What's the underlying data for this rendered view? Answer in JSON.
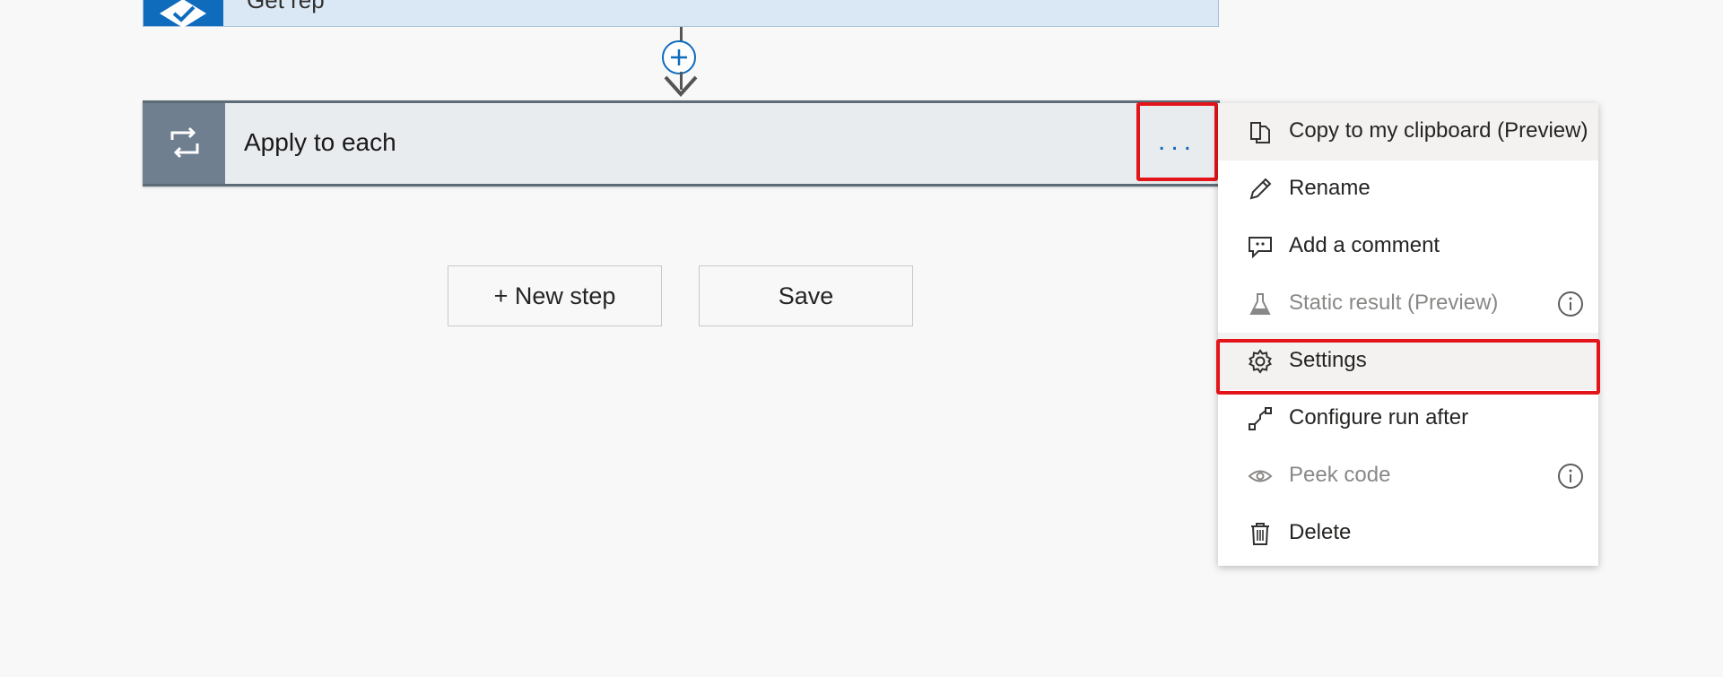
{
  "top_card": {
    "title": "Get rep",
    "icon": "check-icon"
  },
  "connector": {
    "add_icon": "plus-circle-icon",
    "arrow_icon": "arrow-down-icon"
  },
  "apply_card": {
    "title": "Apply to each",
    "icon": "loop-icon",
    "more_label": "..."
  },
  "buttons": {
    "new_step": "+ New step",
    "save": "Save"
  },
  "menu": {
    "items": [
      {
        "label": "Copy to my clipboard (Preview)",
        "icon": "copy-icon",
        "disabled": false
      },
      {
        "label": "Rename",
        "icon": "pencil-icon",
        "disabled": false
      },
      {
        "label": "Add a comment",
        "icon": "comment-icon",
        "disabled": false
      },
      {
        "label": "Static result (Preview)",
        "icon": "flask-icon",
        "disabled": true,
        "info": true
      },
      {
        "label": "Settings",
        "icon": "gear-icon",
        "disabled": false,
        "highlighted": true
      },
      {
        "label": "Configure run after",
        "icon": "run-after-icon",
        "disabled": false
      },
      {
        "label": "Peek code",
        "icon": "eye-icon",
        "disabled": true,
        "info": true
      },
      {
        "label": "Delete",
        "icon": "trash-icon",
        "disabled": false
      }
    ]
  },
  "colors": {
    "accent": "#0f6cbd",
    "highlight_border": "#e3141a",
    "loop_header": "#6f7f8f"
  }
}
